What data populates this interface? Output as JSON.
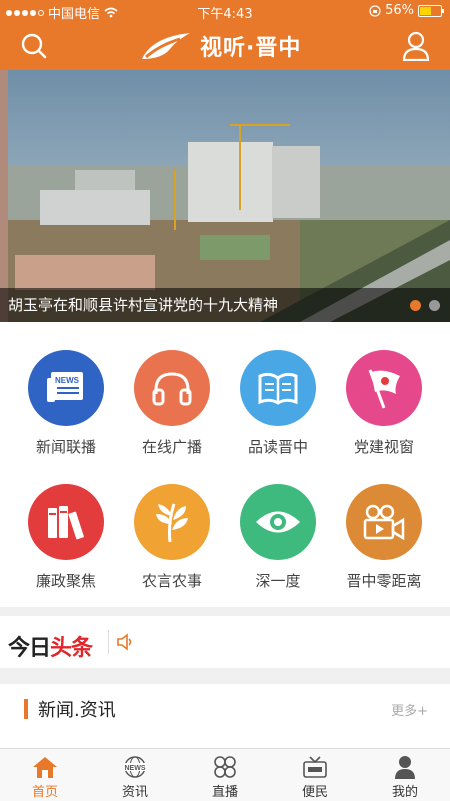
{
  "status_bar": {
    "carrier": "中国电信",
    "time": "下午4:43",
    "battery": "56%",
    "battery_level": 0.56
  },
  "header": {
    "title": "视听·晋中"
  },
  "banner": {
    "caption": "胡玉亭在和顺县许村宣讲党的十九大精神",
    "page_count": 2,
    "active_page": 1
  },
  "grid": {
    "items": [
      {
        "label": "新闻联播",
        "icon": "news-icon",
        "color": "#2f63c4"
      },
      {
        "label": "在线广播",
        "icon": "headphones-icon",
        "color": "#e8734e"
      },
      {
        "label": "品读晋中",
        "icon": "open-book-icon",
        "color": "#4aa7e6"
      },
      {
        "label": "党建视窗",
        "icon": "party-flag-icon",
        "color": "#e6488c"
      },
      {
        "label": "廉政聚焦",
        "icon": "books-icon",
        "color": "#e23c3c"
      },
      {
        "label": "农言农事",
        "icon": "wheat-icon",
        "color": "#f0a232"
      },
      {
        "label": "深一度",
        "icon": "eye-icon",
        "color": "#3fba7e"
      },
      {
        "label": "晋中零距离",
        "icon": "video-camera-icon",
        "color": "#dc8a35"
      }
    ]
  },
  "headline": {
    "brand_a": "今日",
    "brand_b": "头条"
  },
  "news": {
    "title": "新闻.资讯",
    "more": "更多+"
  },
  "tabbar": {
    "tabs": [
      {
        "label": "首页",
        "icon": "home-icon",
        "active": true
      },
      {
        "label": "资讯",
        "icon": "news-globe-icon",
        "active": false
      },
      {
        "label": "直播",
        "icon": "clover-icon",
        "active": false
      },
      {
        "label": "便民",
        "icon": "tv-icon",
        "active": false
      },
      {
        "label": "我的",
        "icon": "person-icon",
        "active": false
      }
    ]
  },
  "colors": {
    "accent": "#e8782a"
  }
}
